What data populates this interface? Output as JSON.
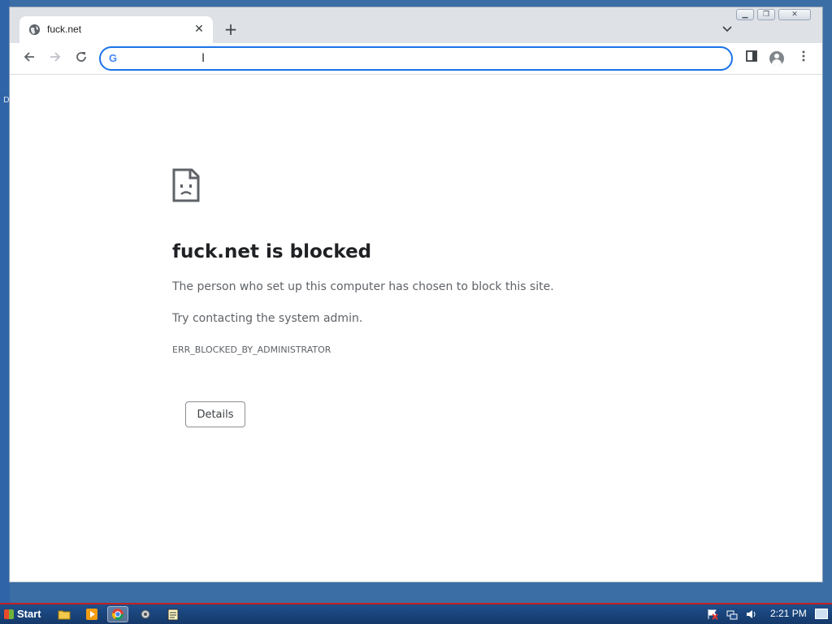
{
  "desktop": {
    "edge_text": "D"
  },
  "browser": {
    "tab": {
      "title": "fuck.net",
      "favicon": "globe-icon",
      "close_icon": "close-icon"
    },
    "new_tab_icon": "plus-icon",
    "tab_search_icon": "chevron-down-icon",
    "window_controls": [
      "minimize-icon",
      "maximize-icon",
      "close-icon"
    ],
    "toolbar": {
      "back_icon": "arrow-left-icon",
      "forward_icon": "arrow-right-icon",
      "reload_icon": "reload-icon",
      "omnibox": {
        "value": "",
        "placeholder": "",
        "provider_icon": "google-g-icon",
        "provider_glyph": "G"
      },
      "side_panel_icon": "side-panel-icon",
      "profile_icon": "profile-avatar-icon",
      "menu_icon": "kebab-menu-icon"
    }
  },
  "error_page": {
    "icon": "sad-page-icon",
    "title": "fuck.net is blocked",
    "description": "The person who set up this computer has chosen to block this site.",
    "hint": "Try contacting the system admin.",
    "error_code": "ERR_BLOCKED_BY_ADMINISTRATOR",
    "details_label": "Details"
  },
  "taskbar": {
    "start_label": "Start",
    "apps": [
      {
        "name": "file-explorer-icon",
        "active": false
      },
      {
        "name": "media-player-icon",
        "active": false
      },
      {
        "name": "chrome-icon",
        "active": true
      },
      {
        "name": "settings-app-icon",
        "active": false
      },
      {
        "name": "notepad-icon",
        "active": false
      }
    ],
    "tray": [
      "action-center-flag-icon",
      "network-icon",
      "volume-icon"
    ],
    "clock": "2:21 PM"
  },
  "colors": {
    "accent": "#1a73e8",
    "taskbar": "#1f4f8c",
    "taskbar_border": "#c32020",
    "desktop": "#3a6ea5"
  }
}
